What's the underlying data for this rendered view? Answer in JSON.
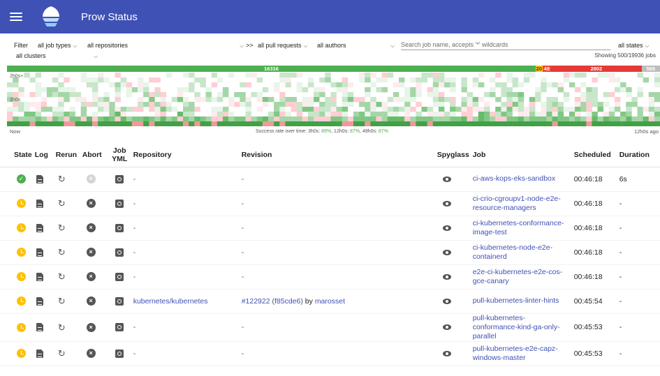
{
  "app": {
    "title": "Prow Status"
  },
  "filters": {
    "filter_label": "Filter",
    "job_types": "all job types",
    "repositories": "all repositories",
    "pull_requests_prefix": ">>",
    "pull_requests": "all pull requests",
    "authors": "all authors",
    "search_placeholder": "Search job name, accepts '*' wildcards",
    "states": "all states",
    "clusters": "all clusters",
    "showing": "Showing 500/19936 jobs"
  },
  "summary_bar": {
    "success": {
      "label": "16316",
      "count": 16316,
      "color": "#4caf50"
    },
    "pending": {
      "label": "20",
      "count": 20,
      "color": "#ffc107"
    },
    "failure1": {
      "label": "48",
      "count": 48,
      "color": "#f44336"
    },
    "failure2": {
      "label": "2802",
      "count": 2802,
      "color": "#e53935"
    },
    "aborted": {
      "label": "565",
      "count": 565,
      "color": "#bdbdbd"
    }
  },
  "histogram": {
    "y_labels": [
      "2h0s+",
      "1h0s"
    ],
    "x_left": "Now",
    "x_right": "12h0s ago",
    "success_text": "Success rate over time: 3h0s: ",
    "rate_3h": "89%",
    "rate_12h_label": ", 12h0s: ",
    "rate_12h": "87%",
    "rate_48h_label": ", 48h0s: ",
    "rate_48h": "87%"
  },
  "table": {
    "headers": {
      "state": "State",
      "log": "Log",
      "rerun": "Rerun",
      "abort": "Abort",
      "job_yml_1": "Job",
      "job_yml_2": "YML",
      "repository": "Repository",
      "revision": "Revision",
      "spyglass": "Spyglass",
      "job": "Job",
      "scheduled": "Scheduled",
      "duration": "Duration"
    },
    "rows": [
      {
        "state": "success",
        "abort_enabled": false,
        "repository": "-",
        "revision": "-",
        "job_1": "ci-aws-kops-eks-sandbox",
        "job_2": "",
        "job_3": "",
        "scheduled": "00:46:18",
        "duration": "6s"
      },
      {
        "state": "pending",
        "abort_enabled": true,
        "repository": "-",
        "revision": "-",
        "job_1": "ci-crio-cgroupv1-node-e2e-",
        "job_2": "resource-managers",
        "job_3": "",
        "scheduled": "00:46:18",
        "duration": "-"
      },
      {
        "state": "pending",
        "abort_enabled": true,
        "repository": "-",
        "revision": "-",
        "job_1": "ci-kubernetes-conformance-",
        "job_2": "image-test",
        "job_3": "",
        "scheduled": "00:46:18",
        "duration": "-"
      },
      {
        "state": "pending",
        "abort_enabled": true,
        "repository": "-",
        "revision": "-",
        "job_1": "ci-kubernetes-node-e2e-",
        "job_2": "containerd",
        "job_3": "",
        "scheduled": "00:46:18",
        "duration": "-"
      },
      {
        "state": "pending",
        "abort_enabled": true,
        "repository": "-",
        "revision": "-",
        "job_1": "e2e-ci-kubernetes-e2e-cos-",
        "job_2": "gce-canary",
        "job_3": "",
        "scheduled": "00:46:18",
        "duration": "-"
      },
      {
        "state": "pending",
        "abort_enabled": true,
        "repository": "kubernetes/kubernetes",
        "revision": "",
        "pr": "#122922",
        "sha": "f85cde6",
        "by": "by",
        "author": "marosset",
        "job_1": "pull-kubernetes-linter-hints",
        "job_2": "",
        "job_3": "",
        "scheduled": "00:45:54",
        "duration": "-"
      },
      {
        "state": "pending",
        "abort_enabled": true,
        "repository": "-",
        "revision": "-",
        "job_1": "pull-kubernetes-",
        "job_2": "conformance-kind-ga-only-",
        "job_3": "parallel",
        "scheduled": "00:45:53",
        "duration": "-"
      },
      {
        "state": "pending",
        "abort_enabled": true,
        "repository": "-",
        "revision": "-",
        "job_1": "pull-kubernetes-e2e-capz-",
        "job_2": "windows-master",
        "job_3": "",
        "scheduled": "00:45:53",
        "duration": "-"
      }
    ]
  }
}
